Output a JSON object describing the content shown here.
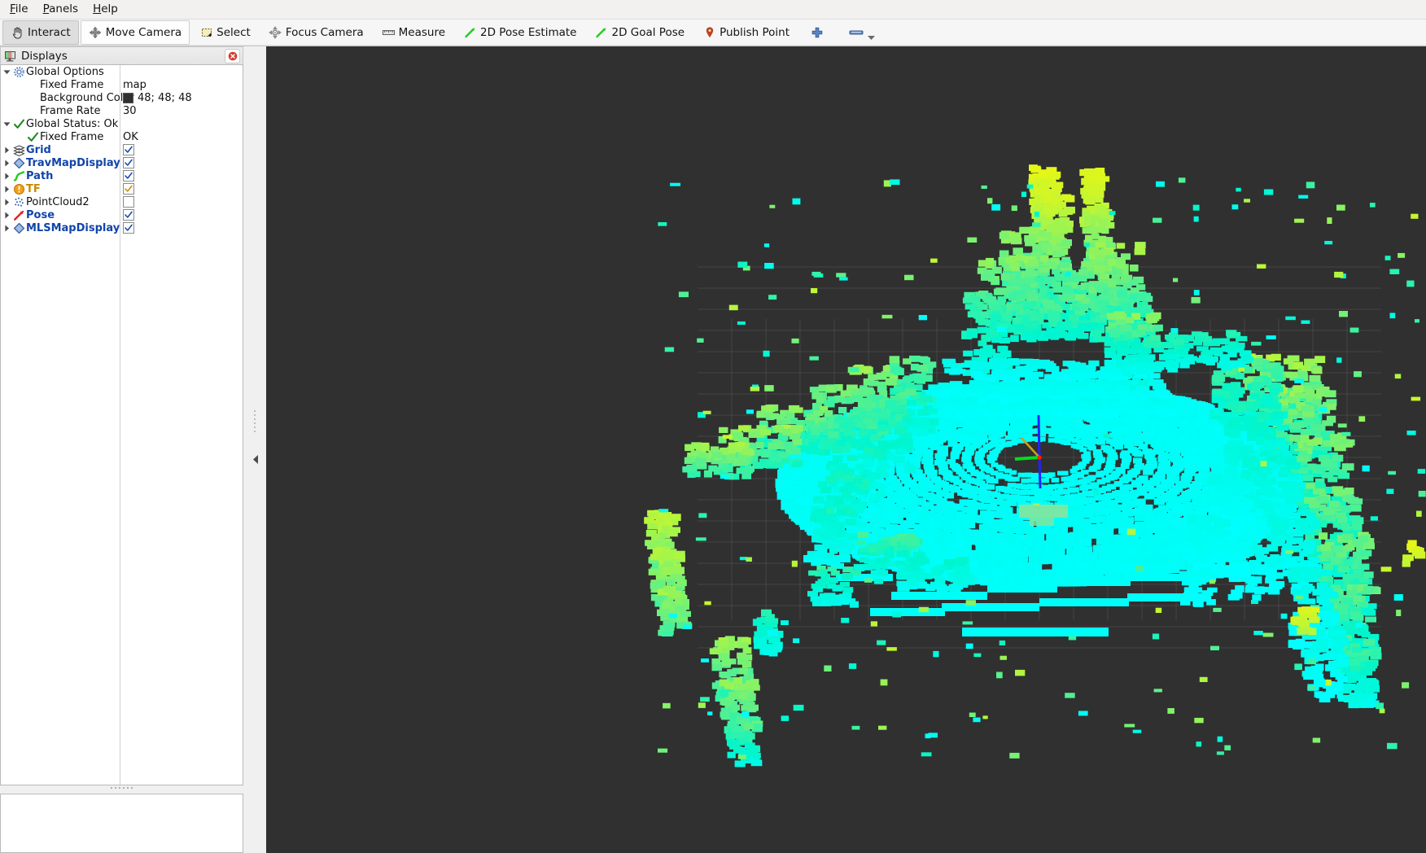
{
  "menubar": {
    "items": [
      {
        "name": "file",
        "label": "File",
        "mnemonic": "F"
      },
      {
        "name": "panels",
        "label": "Panels",
        "mnemonic": "P"
      },
      {
        "name": "help",
        "label": "Help",
        "mnemonic": "H"
      }
    ]
  },
  "toolbar": {
    "buttons": [
      {
        "name": "interact",
        "label": "Interact",
        "icon": "hand-icon",
        "state": "checked"
      },
      {
        "name": "move-camera",
        "label": "Move Camera",
        "icon": "move-camera-icon",
        "state": "raised"
      },
      {
        "name": "select",
        "label": "Select",
        "icon": "select-rect-icon",
        "state": "flat"
      },
      {
        "name": "focus-camera",
        "label": "Focus Camera",
        "icon": "focus-camera-icon",
        "state": "flat"
      },
      {
        "name": "measure",
        "label": "Measure",
        "icon": "ruler-icon",
        "state": "flat"
      },
      {
        "name": "2d-pose-estimate",
        "label": "2D Pose Estimate",
        "icon": "green-arrow-icon",
        "state": "flat"
      },
      {
        "name": "2d-goal-pose",
        "label": "2D Goal Pose",
        "icon": "green-arrow-icon",
        "state": "flat"
      },
      {
        "name": "publish-point",
        "label": "Publish Point",
        "icon": "map-pin-icon",
        "state": "flat"
      },
      {
        "name": "add-tool",
        "label": "",
        "icon": "plus-icon",
        "state": "flat"
      },
      {
        "name": "tool-overflow",
        "label": "",
        "icon": "minus-bar-icon",
        "state": "flat"
      }
    ]
  },
  "displays_panel": {
    "title": "Displays",
    "title_icon": "display-monitor-icon",
    "close_icon": "close-icon",
    "rows": [
      {
        "name": "global-options",
        "label": "Global Options",
        "indent": 0,
        "twist": "down",
        "icon": "gear-icon",
        "style": "plain",
        "value": "",
        "value_type": "none"
      },
      {
        "name": "fixed-frame",
        "label": "Fixed Frame",
        "indent": 1,
        "twist": "none",
        "icon": "none",
        "style": "plain",
        "value": "map",
        "value_type": "text"
      },
      {
        "name": "background-color",
        "label": "Background Color",
        "indent": 1,
        "twist": "none",
        "icon": "none",
        "style": "plain",
        "value": "48; 48; 48",
        "value_type": "color",
        "color": "#303030"
      },
      {
        "name": "frame-rate",
        "label": "Frame Rate",
        "indent": 1,
        "twist": "none",
        "icon": "none",
        "style": "plain",
        "value": "30",
        "value_type": "text"
      },
      {
        "name": "global-status",
        "label": "Global Status: Ok",
        "indent": 0,
        "twist": "down",
        "icon": "check-icon",
        "style": "plain",
        "value": "",
        "value_type": "none"
      },
      {
        "name": "status-fixed-frame",
        "label": "Fixed Frame",
        "indent": 1,
        "twist": "none",
        "icon": "check-icon",
        "style": "plain",
        "value": "OK",
        "value_type": "text"
      },
      {
        "name": "display-grid",
        "label": "Grid",
        "indent": 0,
        "twist": "right",
        "icon": "grid-icon",
        "style": "blue",
        "value": "",
        "value_type": "checkbox",
        "checked": true,
        "check_color": "#1144aa"
      },
      {
        "name": "display-travmapdisplay",
        "label": "TravMapDisplay",
        "indent": 0,
        "twist": "right",
        "icon": "map-diamond-icon",
        "style": "blue",
        "value": "",
        "value_type": "checkbox",
        "checked": true,
        "check_color": "#1144aa"
      },
      {
        "name": "display-path",
        "label": "Path",
        "indent": 0,
        "twist": "right",
        "icon": "path-icon",
        "style": "blue",
        "value": "",
        "value_type": "checkbox",
        "checked": true,
        "check_color": "#1144aa"
      },
      {
        "name": "display-tf",
        "label": "TF",
        "indent": 0,
        "twist": "right",
        "icon": "warning-circle-icon",
        "style": "orange",
        "value": "",
        "value_type": "checkbox",
        "checked": true,
        "check_color": "#cc8800"
      },
      {
        "name": "display-pointcloud2",
        "label": "PointCloud2",
        "indent": 0,
        "twist": "right",
        "icon": "pointcloud-icon",
        "style": "plain",
        "value": "",
        "value_type": "checkbox",
        "checked": false,
        "check_color": "#1144aa"
      },
      {
        "name": "display-pose",
        "label": "Pose",
        "indent": 0,
        "twist": "right",
        "icon": "pose-arrow-icon",
        "style": "blue",
        "value": "",
        "value_type": "checkbox",
        "checked": true,
        "check_color": "#1144aa"
      },
      {
        "name": "display-mlsmapdisplay",
        "label": "MLSMapDisplay",
        "indent": 0,
        "twist": "right",
        "icon": "map-diamond-icon",
        "style": "blue",
        "value": "",
        "value_type": "checkbox",
        "checked": true,
        "check_color": "#1144aa"
      }
    ]
  },
  "viewport": {
    "name": "render-view-3d",
    "background_color": "#303030",
    "grid_color": "#7a7a7a",
    "colormap": {
      "low": "#00ffff",
      "mid": "#44eec0",
      "high": "#eaf712",
      "description": "height colormap cyan(low) to yellow(high)"
    },
    "axes": {
      "x_color": "#ff2200",
      "y_color": "#00dd22",
      "z_color": "#2222ff"
    }
  },
  "splitters": {
    "dock_collapse_icon": "collapse-left-arrow-icon"
  }
}
